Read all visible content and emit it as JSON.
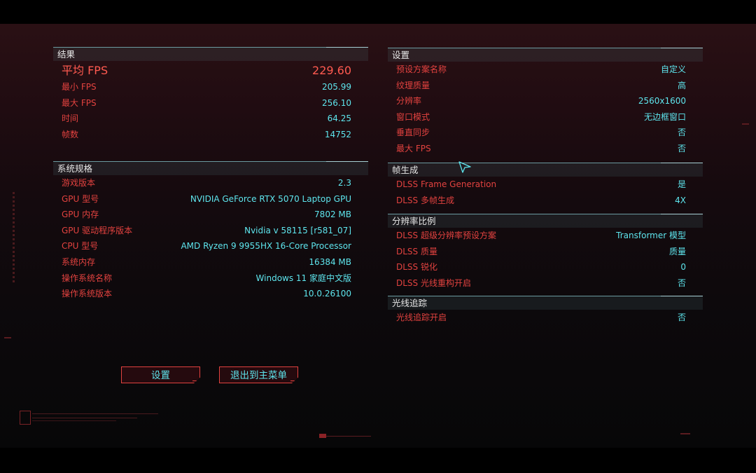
{
  "results": {
    "title": "结果",
    "rows": [
      {
        "label": "平均 FPS",
        "value": "229.60"
      },
      {
        "label": "最小 FPS",
        "value": "205.99"
      },
      {
        "label": "最大 FPS",
        "value": "256.10"
      },
      {
        "label": "时间",
        "value": "64.25"
      },
      {
        "label": "帧数",
        "value": "14752"
      }
    ]
  },
  "system": {
    "title": "系统规格",
    "rows": [
      {
        "label": "游戏版本",
        "value": "2.3"
      },
      {
        "label": "GPU 型号",
        "value": "NVIDIA GeForce RTX 5070 Laptop GPU"
      },
      {
        "label": "GPU 内存",
        "value": "7802 MB"
      },
      {
        "label": "GPU 驱动程序版本",
        "value": "Nvidia v 58115 [r581_07]"
      },
      {
        "label": "CPU 型号",
        "value": "AMD Ryzen 9 9955HX 16-Core Processor"
      },
      {
        "label": "系统内存",
        "value": "16384 MB"
      },
      {
        "label": "操作系统名称",
        "value": "Windows 11 家庭中文版"
      },
      {
        "label": "操作系统版本",
        "value": "10.0.26100"
      }
    ]
  },
  "settings": {
    "title": "设置",
    "rows": [
      {
        "label": "预设方案名称",
        "value": "自定义"
      },
      {
        "label": "纹理质量",
        "value": "高"
      },
      {
        "label": "分辨率",
        "value": "2560x1600"
      },
      {
        "label": "窗口模式",
        "value": "无边框窗口"
      },
      {
        "label": "垂直同步",
        "value": "否"
      },
      {
        "label": "最大 FPS",
        "value": "否"
      }
    ]
  },
  "frame_gen": {
    "title": "帧生成",
    "rows": [
      {
        "label": "DLSS Frame Generation",
        "value": "是"
      },
      {
        "label": "DLSS 多帧生成",
        "value": "4X"
      }
    ]
  },
  "res_scale": {
    "title": "分辨率比例",
    "rows": [
      {
        "label": "DLSS 超级分辨率预设方案",
        "value": "Transformer 模型"
      },
      {
        "label": "DLSS 质量",
        "value": "质量"
      },
      {
        "label": "DLSS 锐化",
        "value": "0"
      },
      {
        "label": "DLSS 光线重构开启",
        "value": "否"
      }
    ]
  },
  "raytracing": {
    "title": "光线追踪",
    "rows": [
      {
        "label": "光线追踪开启",
        "value": "否"
      }
    ]
  },
  "buttons": {
    "settings": "设置",
    "exit": "退出到主菜单"
  },
  "colors": {
    "label_red": "#e2423f",
    "value_cyan": "#5ee6ee",
    "header_line": "#6b9aa0"
  }
}
